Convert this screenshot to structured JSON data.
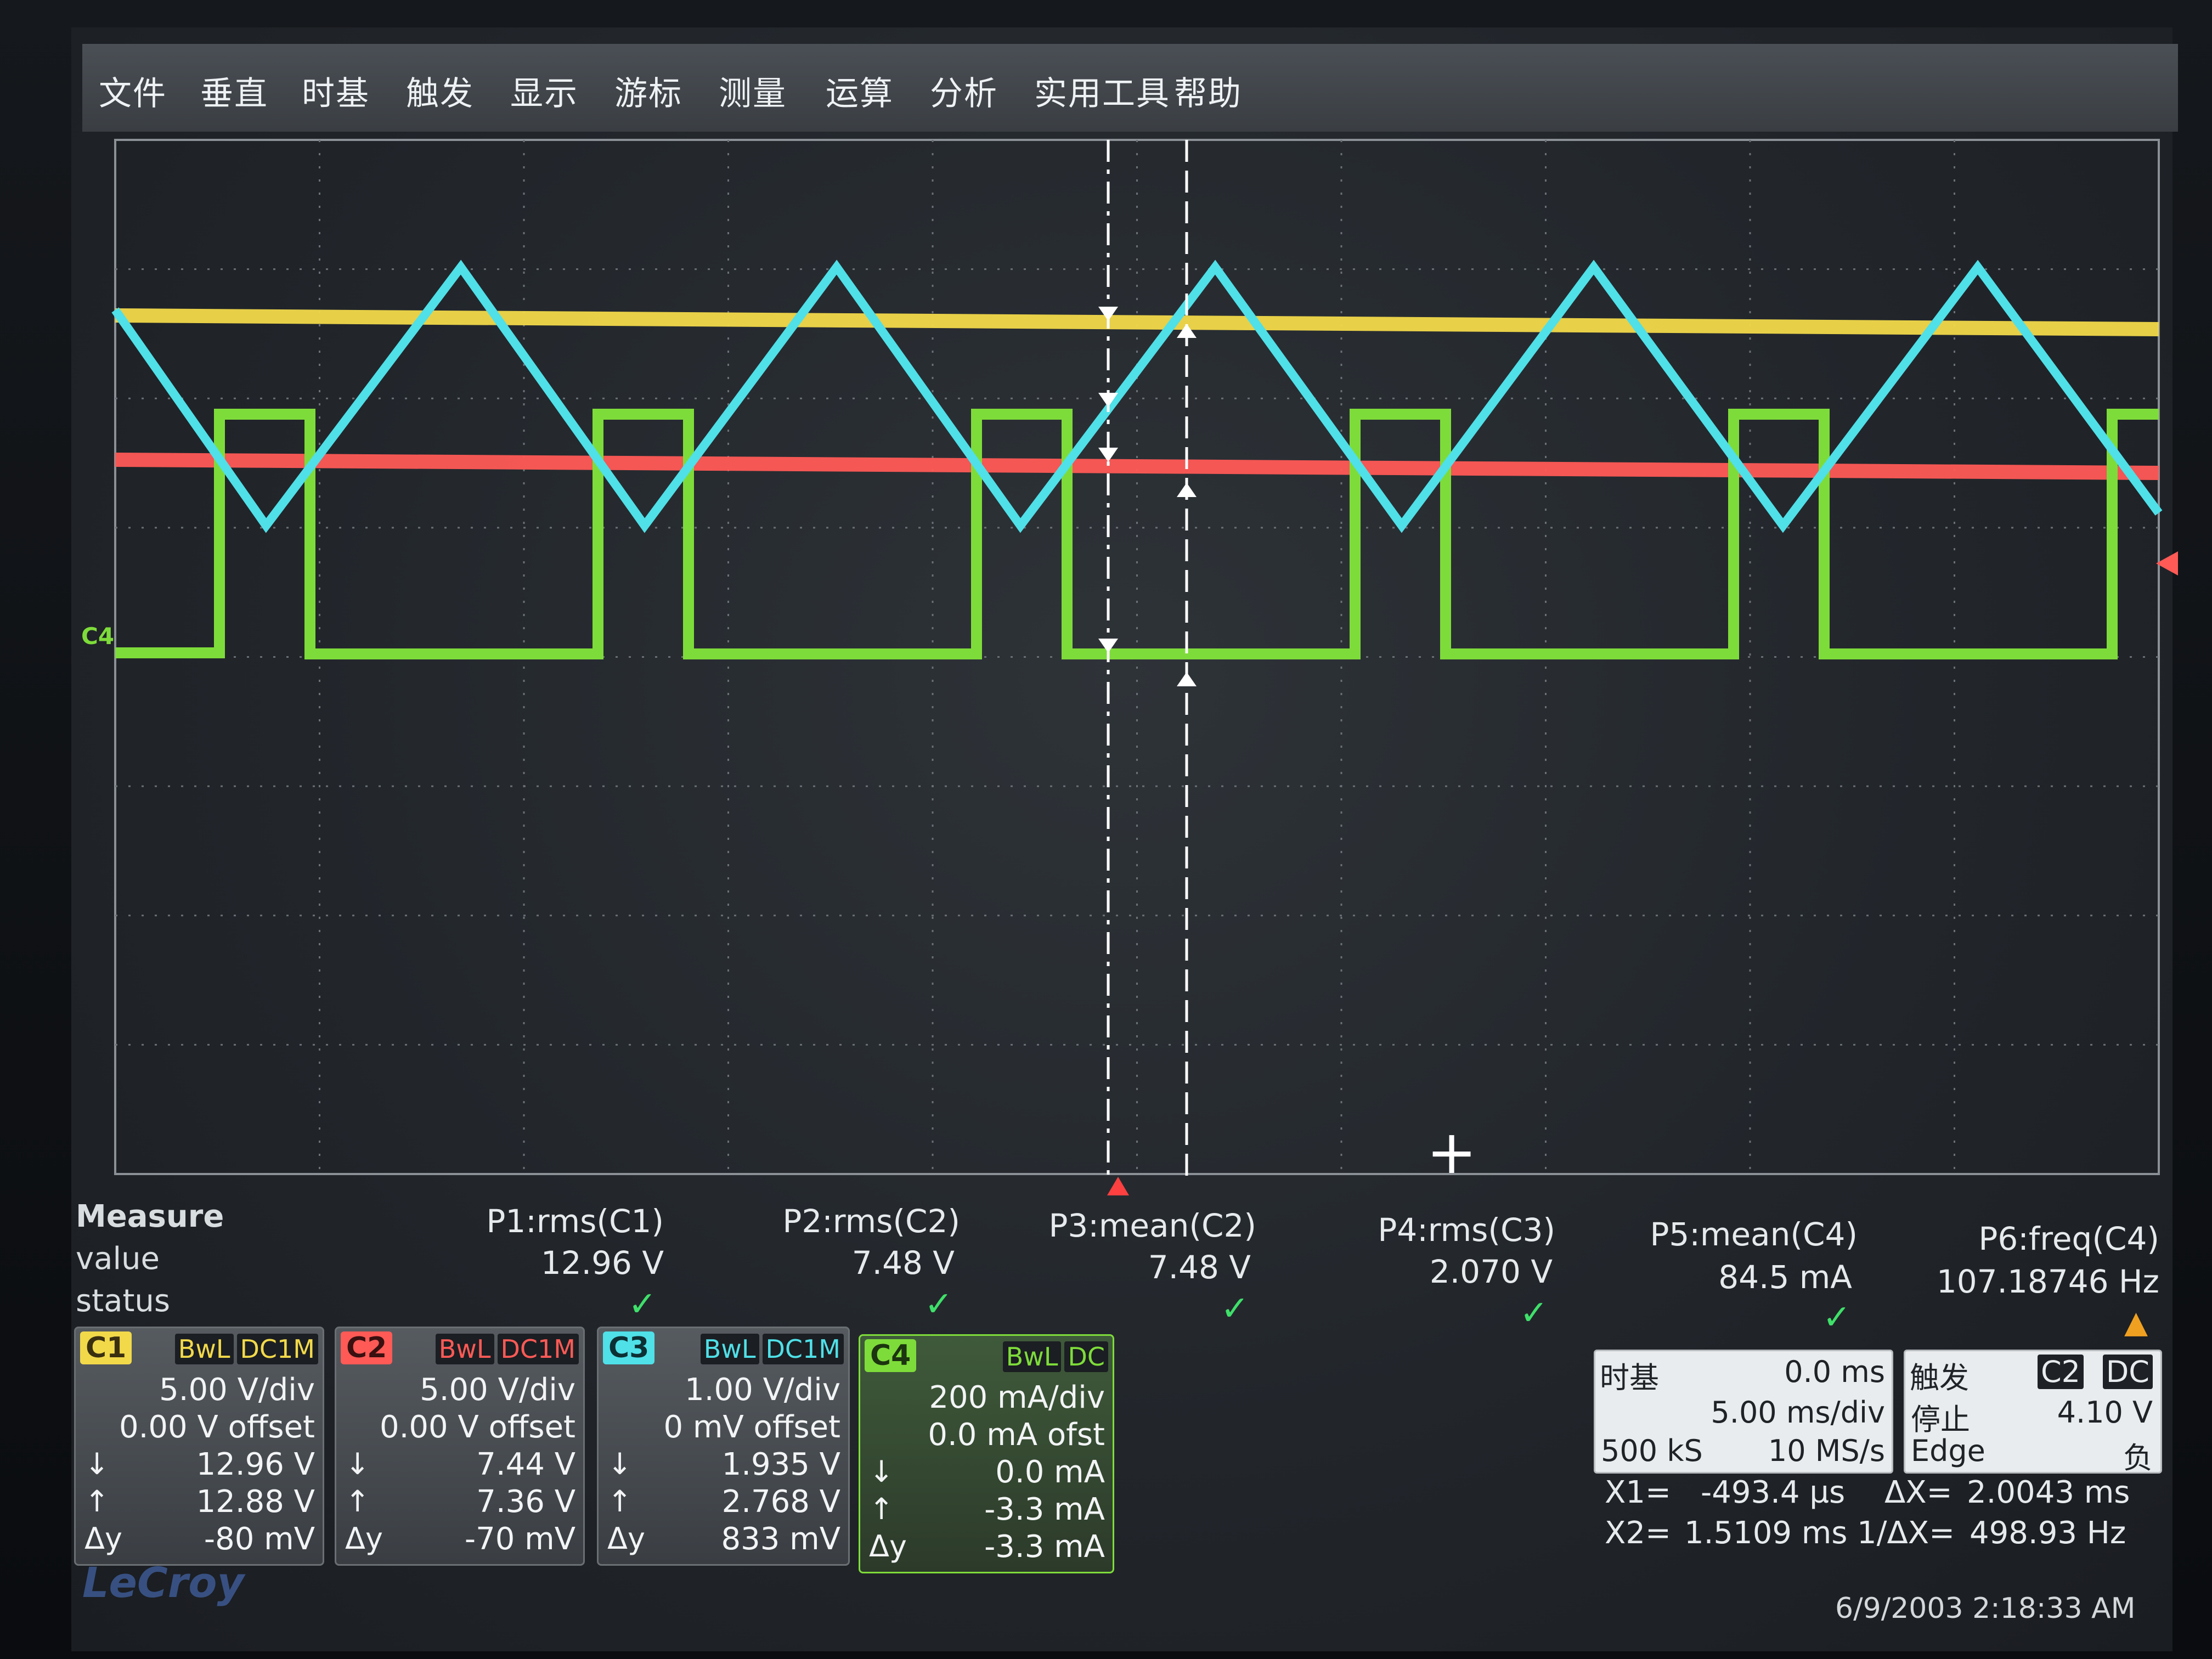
{
  "menu": [
    "文件",
    "垂直",
    "时基",
    "触发",
    "显示",
    "游标",
    "测量",
    "运算",
    "分析",
    "实用工具",
    "帮助"
  ],
  "colors": {
    "c1": "#f2d94a",
    "c2": "#ff5a56",
    "c3": "#4fe0e8",
    "c4": "#7edc3a",
    "bg": "#22262b",
    "grid": "#6a7076"
  },
  "left_marker": "C4",
  "measure": {
    "title": "Measure",
    "row_value": "value",
    "row_status": "status",
    "params": [
      {
        "name": "P1:rms(C1)",
        "value": "12.96 V",
        "status": "ok"
      },
      {
        "name": "P2:rms(C2)",
        "value": "7.48 V",
        "status": "ok"
      },
      {
        "name": "P3:mean(C2)",
        "value": "7.48 V",
        "status": "ok"
      },
      {
        "name": "P4:rms(C3)",
        "value": "2.070 V",
        "status": "ok"
      },
      {
        "name": "P5:mean(C4)",
        "value": "84.5 mA",
        "status": "ok"
      },
      {
        "name": "P6:freq(C4)",
        "value": "107.18746 Hz",
        "status": "warning"
      }
    ]
  },
  "channels": [
    {
      "tag": "C1",
      "bw": "BwL",
      "cpl": "DC1M",
      "scale": "5.00 V/div",
      "offset": "0.00 V offset",
      "down": "12.96 V",
      "up": "12.88 V",
      "dy": "-80 mV",
      "color": "#f2d94a"
    },
    {
      "tag": "C2",
      "bw": "BwL",
      "cpl": "DC1M",
      "scale": "5.00 V/div",
      "offset": "0.00 V offset",
      "down": "7.44 V",
      "up": "7.36 V",
      "dy": "-70 mV",
      "color": "#ff5a56"
    },
    {
      "tag": "C3",
      "bw": "BwL",
      "cpl": "DC1M",
      "scale": "1.00 V/div",
      "offset": "0 mV offset",
      "down": "1.935 V",
      "up": "2.768 V",
      "dy": "833 mV",
      "color": "#4fe0e8"
    },
    {
      "tag": "C4",
      "bw": "BwL",
      "cpl": "DC",
      "scale": "200 mA/div",
      "offset": "0.0 mA ofst",
      "down": "0.0 mA",
      "up": "-3.3 mA",
      "dy": "-3.3 mA",
      "color": "#7edc3a"
    }
  ],
  "symbols": {
    "down": "↓",
    "up": "↑",
    "dy": "Δy"
  },
  "timebase": {
    "title": "时基",
    "delay": "0.0 ms",
    "scale": "5.00 ms/div",
    "samples": "500 kS",
    "rate": "10 MS/s"
  },
  "trigger": {
    "title": "触发",
    "source": "C2",
    "coupling": "DC",
    "mode": "停止",
    "level": "4.10 V",
    "type": "Edge",
    "slope": "负"
  },
  "cursors": {
    "x1_label": "X1=",
    "x1": "-493.4 µs",
    "dx_label": "ΔX=",
    "dx": "2.0043 ms",
    "x2_label": "X2=",
    "x2": "1.5109 ms",
    "inv_label": "1/ΔX=",
    "inv": "498.93 Hz"
  },
  "datetime": "6/9/2003 2:18:33 AM",
  "brand": "LeCroy"
}
